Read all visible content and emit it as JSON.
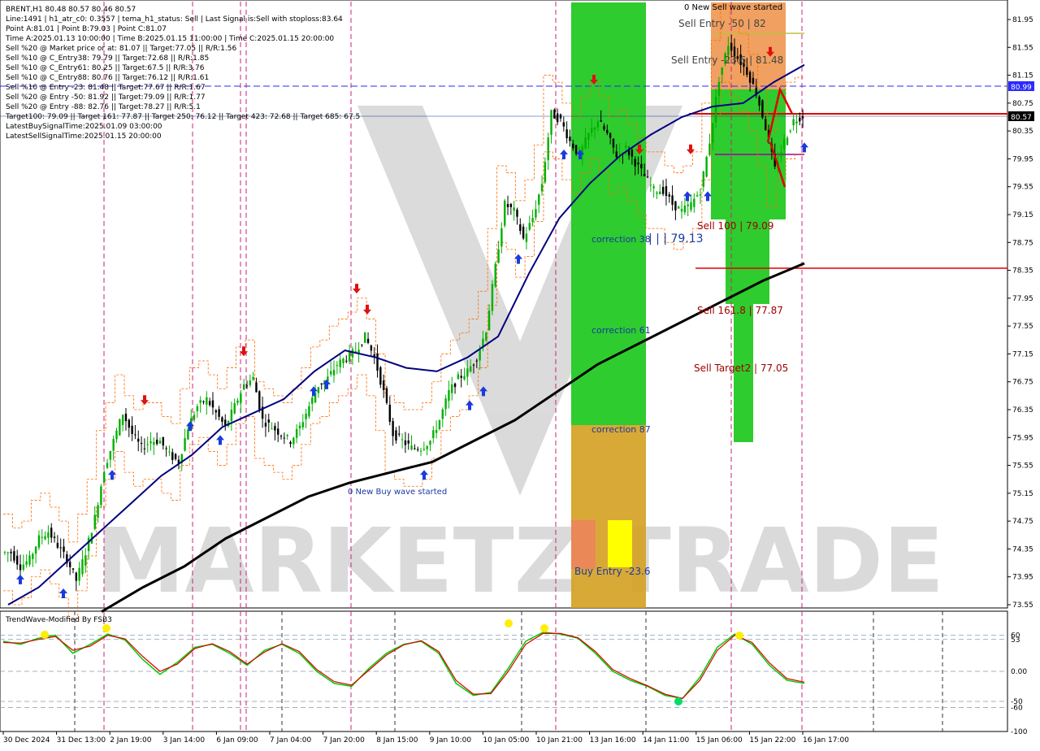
{
  "window": {
    "symbol_line": "BRENT,H1  80.48 80.57 80.46 80.57"
  },
  "info_lines": [
    "Line:1491 | h1_atr_c0: 0.3557 | tema_h1_status: Sell | Last Signal is:Sell with stoploss:83.64",
    "Point A:81.01 | Point B:79.03 | Point C:81.07",
    "Time A:2025.01.13 10:00:00 | Time B:2025.01.15 11:00:00 | Time C:2025.01.15 20:00:00",
    "Sell %20 @ Market price or at: 81.07 || Target:77.05 || R/R:1.56",
    "Sell %10 @ C_Entry38: 79.79 || Target:72.68 || R/R:1.85",
    "Sell %10 @ C_Entry61: 80.25 || Target:67.5 || R/R:3.76",
    "Sell %10 @ C_Entry88: 80.76 || Target:76.12 || R/R:1.61",
    "Sell %10 @ Entry -23: 81.48 || Target:77.67 || R/R:1.67",
    "Sell %20 @ Entry -50: 81.92 || Target:79.09 || R/R:1.77",
    "Sell %20 @ Entry -88: 82.76 || Target:78.27 || R/R:5.1",
    "Target100: 79.09 || Target 161: 77.87 || Target 250: 76.12 || Target 423: 72.68 || Target 685: 67.5",
    "LatestBuySignalTime:2025.01.09 03:00:00",
    "LatestSellSignalTime:2025.01.15 20:00:00"
  ],
  "price_axis": {
    "ticks": [
      "81.95",
      "81.55",
      "81.15",
      "80.75",
      "80.35",
      "79.95",
      "79.55",
      "79.15",
      "78.75",
      "78.35",
      "77.95",
      "77.55",
      "77.15",
      "76.75",
      "76.35",
      "75.95",
      "75.55",
      "75.15",
      "74.75",
      "74.35",
      "73.95",
      "73.55"
    ],
    "tags": [
      {
        "value": "80.99",
        "color": "#2a2aff"
      },
      {
        "value": "80.57",
        "color": "#000000"
      }
    ]
  },
  "time_axis": [
    "30 Dec 2024",
    "31 Dec 13:00",
    "2 Jan 19:00",
    "3 Jan 14:00",
    "6 Jan 09:00",
    "7 Jan 04:00",
    "7 Jan 20:00",
    "8 Jan 15:00",
    "9 Jan 10:00",
    "10 Jan 05:00",
    "10 Jan 21:00",
    "13 Jan 16:00",
    "14 Jan 11:00",
    "15 Jan 06:00",
    "15 Jan 22:00",
    "16 Jan 17:00"
  ],
  "annotations": {
    "new_sell_wave": "0 New Sell wave started",
    "new_buy_wave": "0 New Buy wave started",
    "sell_entry_50": "Sell Entry -50 | 82",
    "sell_entry_23": "Sell Entry -23.6 | 81.48",
    "sell_100": "Sell 100 | 79.09",
    "sell_161": "Sell 161.8 | 77.87",
    "sell_target2": "Sell Target2 | 77.05",
    "correction_38": "correction 38",
    "correction_61": "correction 61",
    "correction_87": "correction 87",
    "buy_entry": "Buy Entry -23.6",
    "level_label": "| | | 79.13"
  },
  "watermark": "MARKETZ TRADE",
  "indicator": {
    "title": "TrendWave-Modified By FSB3",
    "levels": [
      "60",
      "53",
      "0.00",
      "-50",
      "-60",
      "-100"
    ]
  },
  "colors": {
    "background": "#ffffff",
    "bull_candle": "#00b000",
    "bear_candle": "#000000",
    "ma_fast": "#000080",
    "ma_slow": "#000000",
    "envelope": "#ff6a00",
    "sell_zone": "#f0a060",
    "buy_zone": "#2ecc2e",
    "target_line": "#e00000",
    "osc_fast": "#00cc00",
    "osc_slow": "#dd0000"
  },
  "chart_data": {
    "type": "candlestick",
    "symbol": "BRENT",
    "timeframe": "H1",
    "y_range": [
      73.45,
      82.05
    ],
    "ohlc_last": {
      "open": 80.48,
      "high": 80.57,
      "low": 80.46,
      "close": 80.57
    },
    "price_path": [
      74.3,
      74.1,
      74.2,
      74.5,
      74.6,
      74.4,
      74.2,
      73.9,
      74.3,
      74.8,
      75.5,
      75.9,
      76.3,
      76.0,
      75.8,
      75.9,
      75.9,
      75.7,
      75.6,
      76.1,
      76.4,
      76.5,
      76.3,
      76.1,
      76.4,
      76.7,
      76.8,
      76.2,
      76.1,
      76.0,
      75.9,
      76.1,
      76.4,
      76.7,
      76.8,
      77.0,
      77.1,
      77.2,
      77.4,
      77.1,
      76.6,
      76.0,
      75.9,
      75.8,
      75.8,
      75.9,
      76.2,
      76.6,
      76.8,
      76.9,
      77.1,
      77.5,
      78.4,
      79.3,
      79.2,
      78.8,
      79.1,
      79.6,
      80.6,
      80.5,
      80.2,
      80.0,
      80.3,
      80.5,
      80.3,
      80.0,
      80.1,
      79.9,
      79.7,
      79.5,
      79.5,
      79.3,
      79.2,
      79.3,
      79.5,
      80.2,
      81.1,
      81.6,
      81.4,
      81.2,
      80.9,
      80.4,
      79.8,
      80.2,
      80.5,
      80.57
    ],
    "ma_fast": [
      73.55,
      73.8,
      74.2,
      74.6,
      75.0,
      75.4,
      75.7,
      76.1,
      76.3,
      76.5,
      76.9,
      77.2,
      77.1,
      76.95,
      76.9,
      77.1,
      77.4,
      78.3,
      79.1,
      79.6,
      80.0,
      80.3,
      80.55,
      80.7,
      80.75,
      81.05,
      81.3
    ],
    "ma_slow": [
      73.45,
      73.8,
      74.1,
      74.5,
      74.8,
      75.1,
      75.3,
      75.45,
      75.6,
      75.9,
      76.2,
      76.6,
      77.0,
      77.3,
      77.6,
      77.9,
      78.2,
      78.45
    ],
    "levels": {
      "sell_entry_50": 82.0,
      "sell_entry_23": 81.48,
      "sell_100": 79.09,
      "sell_161": 77.87,
      "sell_target2": 77.05,
      "price_80_99": 80.99,
      "price_80_57": 80.57,
      "target_78_35": 78.35
    },
    "oscillator": {
      "range": [
        -100,
        100
      ],
      "levels": [
        60,
        53,
        0,
        -50,
        -60,
        -100
      ],
      "fast": [
        50,
        45,
        55,
        60,
        30,
        45,
        62,
        52,
        20,
        -5,
        15,
        40,
        45,
        30,
        10,
        35,
        45,
        30,
        0,
        -20,
        -25,
        5,
        30,
        45,
        50,
        30,
        -20,
        -40,
        -35,
        5,
        50,
        65,
        62,
        55,
        30,
        0,
        -15,
        -25,
        -40,
        -45,
        -10,
        40,
        62,
        45,
        10,
        -15,
        -20
      ],
      "slow": [
        48,
        47,
        53,
        58,
        35,
        42,
        60,
        54,
        25,
        0,
        12,
        38,
        46,
        33,
        12,
        32,
        46,
        33,
        3,
        -17,
        -23,
        2,
        27,
        44,
        51,
        33,
        -15,
        -38,
        -37,
        0,
        45,
        63,
        63,
        56,
        33,
        3,
        -12,
        -24,
        -38,
        -45,
        -15,
        35,
        60,
        48,
        14,
        -12,
        -18
      ]
    }
  }
}
